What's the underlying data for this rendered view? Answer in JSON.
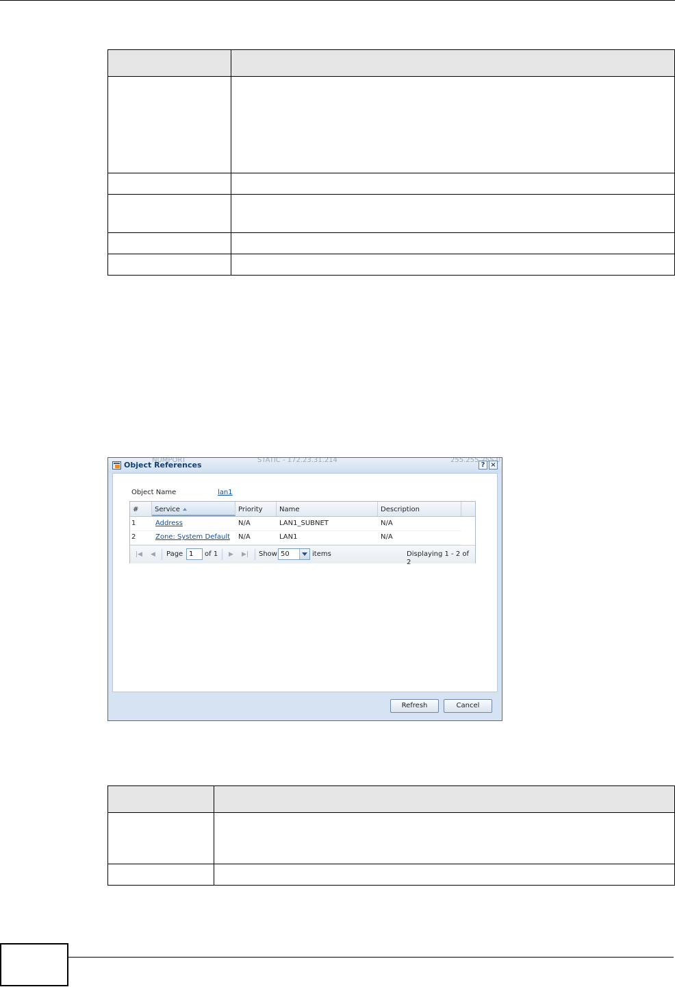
{
  "dialog": {
    "title": "Object References",
    "help_icon": "?",
    "close_icon": "×",
    "background_ghost": {
      "left": "NUMPORT",
      "middle": "STATIC - 172.23.31.214",
      "right": "255.255.255.0"
    },
    "object_name_label": "Object Name",
    "object_name_value": "lan1",
    "columns": [
      "#",
      "Service",
      "Priority",
      "Name",
      "Description"
    ],
    "rows": [
      {
        "num": "1",
        "service": "Address",
        "priority": "N/A",
        "name": "LAN1_SUBNET",
        "description": "N/A"
      },
      {
        "num": "2",
        "service": "Zone: System Default",
        "priority": "N/A",
        "name": "LAN1",
        "description": "N/A"
      }
    ],
    "pager": {
      "page_label": "Page",
      "page_value": "1",
      "of_label": "of 1",
      "show_label": "Show",
      "show_value": "50",
      "items_label": "items",
      "displaying": "Displaying 1 - 2 of 2"
    },
    "buttons": {
      "refresh": "Refresh",
      "cancel": "Cancel"
    }
  },
  "colors": {
    "dialog_frame": "#d6e3f2",
    "title_text": "#153e6e",
    "link": "#0b4da2",
    "table_header": "#e6e6e6"
  }
}
